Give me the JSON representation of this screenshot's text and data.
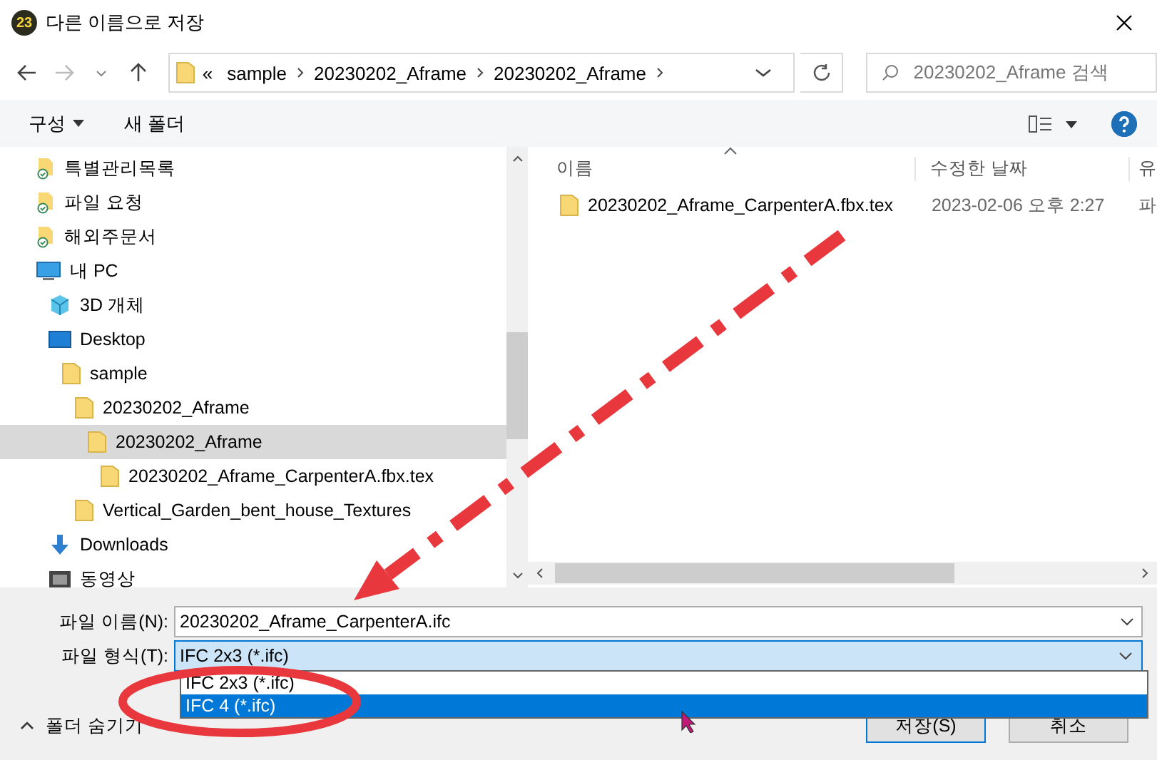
{
  "window": {
    "app_icon_text": "23",
    "title": "다른 이름으로 저장"
  },
  "address_bar": {
    "breadcrumbs": [
      "«",
      "sample",
      "20230202_Aframe",
      "20230202_Aframe"
    ],
    "search_placeholder": "20230202_Aframe 검색"
  },
  "toolbar": {
    "organize": "구성",
    "new_folder": "새 폴더"
  },
  "tree": [
    {
      "label": "특별관리목록",
      "kind": "synced",
      "selected": false
    },
    {
      "label": "파일 요청",
      "kind": "synced",
      "selected": false
    },
    {
      "label": "해외주문서",
      "kind": "synced",
      "selected": false
    },
    {
      "label": "내 PC",
      "kind": "pc",
      "selected": false,
      "children": [
        {
          "label": "3D 개체",
          "kind": "cube",
          "selected": false
        },
        {
          "label": "Desktop",
          "kind": "desktop",
          "selected": false,
          "children": [
            {
              "label": "sample",
              "kind": "folder",
              "selected": false,
              "children": [
                {
                  "label": "20230202_Aframe",
                  "kind": "folder",
                  "selected": false,
                  "children": [
                    {
                      "label": "20230202_Aframe",
                      "kind": "folder",
                      "selected": true,
                      "children": [
                        {
                          "label": "20230202_Aframe_CarpenterA.fbx.tex",
                          "kind": "folder",
                          "selected": false
                        }
                      ]
                    }
                  ]
                },
                {
                  "label": "Vertical_Garden_bent_house_Textures",
                  "kind": "folder",
                  "selected": false
                }
              ]
            }
          ]
        },
        {
          "label": "Downloads",
          "kind": "download",
          "selected": false
        },
        {
          "label": "동영상",
          "kind": "video",
          "selected": false
        }
      ]
    }
  ],
  "file_list": {
    "columns": [
      "이름",
      "수정한 날짜",
      "유"
    ],
    "rows": [
      {
        "name": "20230202_Aframe_CarpenterA.fbx.tex",
        "modified": "2023-02-06 오후 2:27",
        "type": "파",
        "selected": false
      }
    ]
  },
  "file_name": {
    "label": "파일 이름(N):",
    "value": "20230202_Aframe_CarpenterA.ifc"
  },
  "file_type": {
    "label": "파일 형식(T):",
    "value": "IFC 2x3 (*.ifc)",
    "expanded": true,
    "options": [
      {
        "label": "IFC 2x3 (*.ifc)",
        "highlighted": false
      },
      {
        "label": "IFC 4 (*.ifc)",
        "highlighted": true
      }
    ]
  },
  "hide_folders": "폴더 숨기기",
  "buttons": {
    "save": "저장(S)",
    "cancel": "취소"
  }
}
